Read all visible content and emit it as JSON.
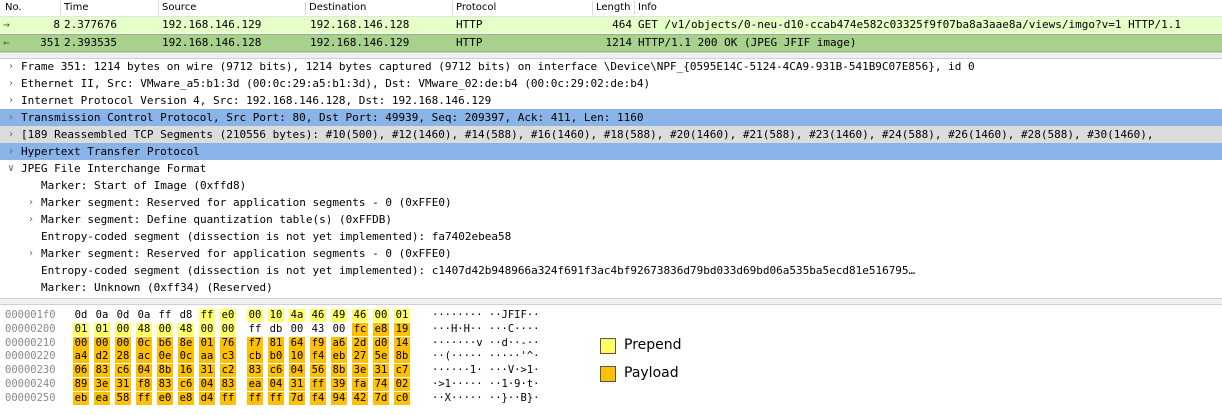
{
  "packet_list": {
    "headers": {
      "no": "No.",
      "time": "Time",
      "source": "Source",
      "destination": "Destination",
      "protocol": "Protocol",
      "length": "Length",
      "info": "Info"
    },
    "rows": [
      {
        "no": "8",
        "time": "2.377676",
        "source": "192.168.146.129",
        "destination": "192.168.146.128",
        "protocol": "HTTP",
        "length": "464",
        "info": "GET /v1/objects/0-neu-d10-ccab474e582c03325f9f07ba8a3aae8a/views/imgo?v=1 HTTP/1.1"
      },
      {
        "no": "351",
        "time": "2.393535",
        "source": "192.168.146.128",
        "destination": "192.168.146.129",
        "protocol": "HTTP",
        "length": "1214",
        "info": "HTTP/1.1 200 OK  (JPEG JFIF image)"
      }
    ]
  },
  "details": [
    {
      "text": "Frame 351: 1214 bytes on wire (9712 bits), 1214 bytes captured (9712 bits) on interface \\Device\\NPF_{0595E14C-5124-4CA9-931B-541B9C07E856}, id 0",
      "expander": ">",
      "indent": 0,
      "hl": ""
    },
    {
      "text": "Ethernet II, Src: VMware_a5:b1:3d (00:0c:29:a5:b1:3d), Dst: VMware_02:de:b4 (00:0c:29:02:de:b4)",
      "expander": ">",
      "indent": 0,
      "hl": ""
    },
    {
      "text": "Internet Protocol Version 4, Src: 192.168.146.128, Dst: 192.168.146.129",
      "expander": ">",
      "indent": 0,
      "hl": ""
    },
    {
      "text": "Transmission Control Protocol, Src Port: 80, Dst Port: 49939, Seq: 209397, Ack: 411, Len: 1160",
      "expander": ">",
      "indent": 0,
      "hl": "blue"
    },
    {
      "text": "[189 Reassembled TCP Segments (210556 bytes): #10(500), #12(1460), #14(588), #16(1460), #18(588), #20(1460), #21(588), #23(1460), #24(588), #26(1460), #28(588), #30(1460),",
      "expander": ">",
      "indent": 0,
      "hl": "grey"
    },
    {
      "text": "Hypertext Transfer Protocol",
      "expander": ">",
      "indent": 0,
      "hl": "blue"
    },
    {
      "text": "JPEG File Interchange Format",
      "expander": "v",
      "indent": 0,
      "hl": ""
    },
    {
      "text": "Marker: Start of Image (0xffd8)",
      "expander": "",
      "indent": 1,
      "hl": ""
    },
    {
      "text": "Marker segment: Reserved for application segments - 0 (0xFFE0)",
      "expander": ">",
      "indent": 1,
      "hl": ""
    },
    {
      "text": "Marker segment: Define quantization table(s) (0xFFDB)",
      "expander": ">",
      "indent": 1,
      "hl": ""
    },
    {
      "text": "Entropy-coded segment (dissection is not yet implemented): fa7402ebea58",
      "expander": "",
      "indent": 1,
      "hl": ""
    },
    {
      "text": "Marker segment: Reserved for application segments - 0 (0xFFE0)",
      "expander": ">",
      "indent": 1,
      "hl": ""
    },
    {
      "text": "Entropy-coded segment (dissection is not yet implemented): c1407d42b948966a324f691f3ac4bf92673836d79bd033d69bd06a535ba5ecd81e516795…",
      "expander": "",
      "indent": 1,
      "hl": ""
    },
    {
      "text": "Marker: Unknown (0xff34) (Reserved)",
      "expander": "",
      "indent": 1,
      "hl": ""
    }
  ],
  "hex_rows": [
    {
      "offset": "000001f0",
      "bytes": [
        "0d",
        "0a",
        "0d",
        "0a",
        "ff",
        "d8",
        "ff",
        "e0",
        "00",
        "10",
        "4a",
        "46",
        "49",
        "46",
        "00",
        "01"
      ],
      "hl": [
        "",
        "",
        "",
        "",
        "",
        "",
        "p",
        "p",
        "p",
        "p",
        "p",
        "p",
        "p",
        "p",
        "p",
        "p"
      ],
      "ascii": "········ ··JFIF··"
    },
    {
      "offset": "00000200",
      "bytes": [
        "01",
        "01",
        "00",
        "48",
        "00",
        "48",
        "00",
        "00",
        "ff",
        "db",
        "00",
        "43",
        "00",
        "fc",
        "e8",
        "19"
      ],
      "hl": [
        "p",
        "p",
        "p",
        "p",
        "p",
        "p",
        "p",
        "p",
        "",
        "",
        "",
        "",
        "",
        "y",
        "y",
        "y"
      ],
      "ascii": "···H·H·· ···C····"
    },
    {
      "offset": "00000210",
      "bytes": [
        "00",
        "00",
        "00",
        "0c",
        "b6",
        "8e",
        "01",
        "76",
        "f7",
        "81",
        "64",
        "f9",
        "a6",
        "2d",
        "d0",
        "14"
      ],
      "hl": [
        "y",
        "y",
        "y",
        "y",
        "y",
        "y",
        "y",
        "y",
        "y",
        "y",
        "y",
        "y",
        "y",
        "y",
        "y",
        "y"
      ],
      "ascii": "·······v ··d··-··"
    },
    {
      "offset": "00000220",
      "bytes": [
        "a4",
        "d2",
        "28",
        "ac",
        "0e",
        "0c",
        "aa",
        "c3",
        "cb",
        "b0",
        "10",
        "f4",
        "eb",
        "27",
        "5e",
        "8b"
      ],
      "hl": [
        "y",
        "y",
        "y",
        "y",
        "y",
        "y",
        "y",
        "y",
        "y",
        "y",
        "y",
        "y",
        "y",
        "y",
        "y",
        "y"
      ],
      "ascii": "··(····· ·····'^·"
    },
    {
      "offset": "00000230",
      "bytes": [
        "06",
        "83",
        "c6",
        "04",
        "8b",
        "16",
        "31",
        "c2",
        "83",
        "c6",
        "04",
        "56",
        "8b",
        "3e",
        "31",
        "c7"
      ],
      "hl": [
        "y",
        "y",
        "y",
        "y",
        "y",
        "y",
        "y",
        "y",
        "y",
        "y",
        "y",
        "y",
        "y",
        "y",
        "y",
        "y"
      ],
      "ascii": "······1· ···V·>1·"
    },
    {
      "offset": "00000240",
      "bytes": [
        "89",
        "3e",
        "31",
        "f8",
        "83",
        "c6",
        "04",
        "83",
        "ea",
        "04",
        "31",
        "ff",
        "39",
        "fa",
        "74",
        "02"
      ],
      "hl": [
        "y",
        "y",
        "y",
        "y",
        "y",
        "y",
        "y",
        "y",
        "y",
        "y",
        "y",
        "y",
        "y",
        "y",
        "y",
        "y"
      ],
      "ascii": "·>1····· ··1·9·t·"
    },
    {
      "offset": "00000250",
      "bytes": [
        "eb",
        "ea",
        "58",
        "ff",
        "e0",
        "e8",
        "d4",
        "ff",
        "ff",
        "ff",
        "7d",
        "f4",
        "94",
        "42",
        "7d",
        "c0"
      ],
      "hl": [
        "y",
        "y",
        "y",
        "y",
        "y",
        "y",
        "y",
        "y",
        "y",
        "y",
        "y",
        "y",
        "y",
        "y",
        "y",
        "y"
      ],
      "ascii": "··X····· ··}··B}·"
    }
  ],
  "legend": [
    {
      "label": "Prepend",
      "color": "#ffff66"
    },
    {
      "label": "Payload",
      "color": "#ffc000"
    }
  ]
}
